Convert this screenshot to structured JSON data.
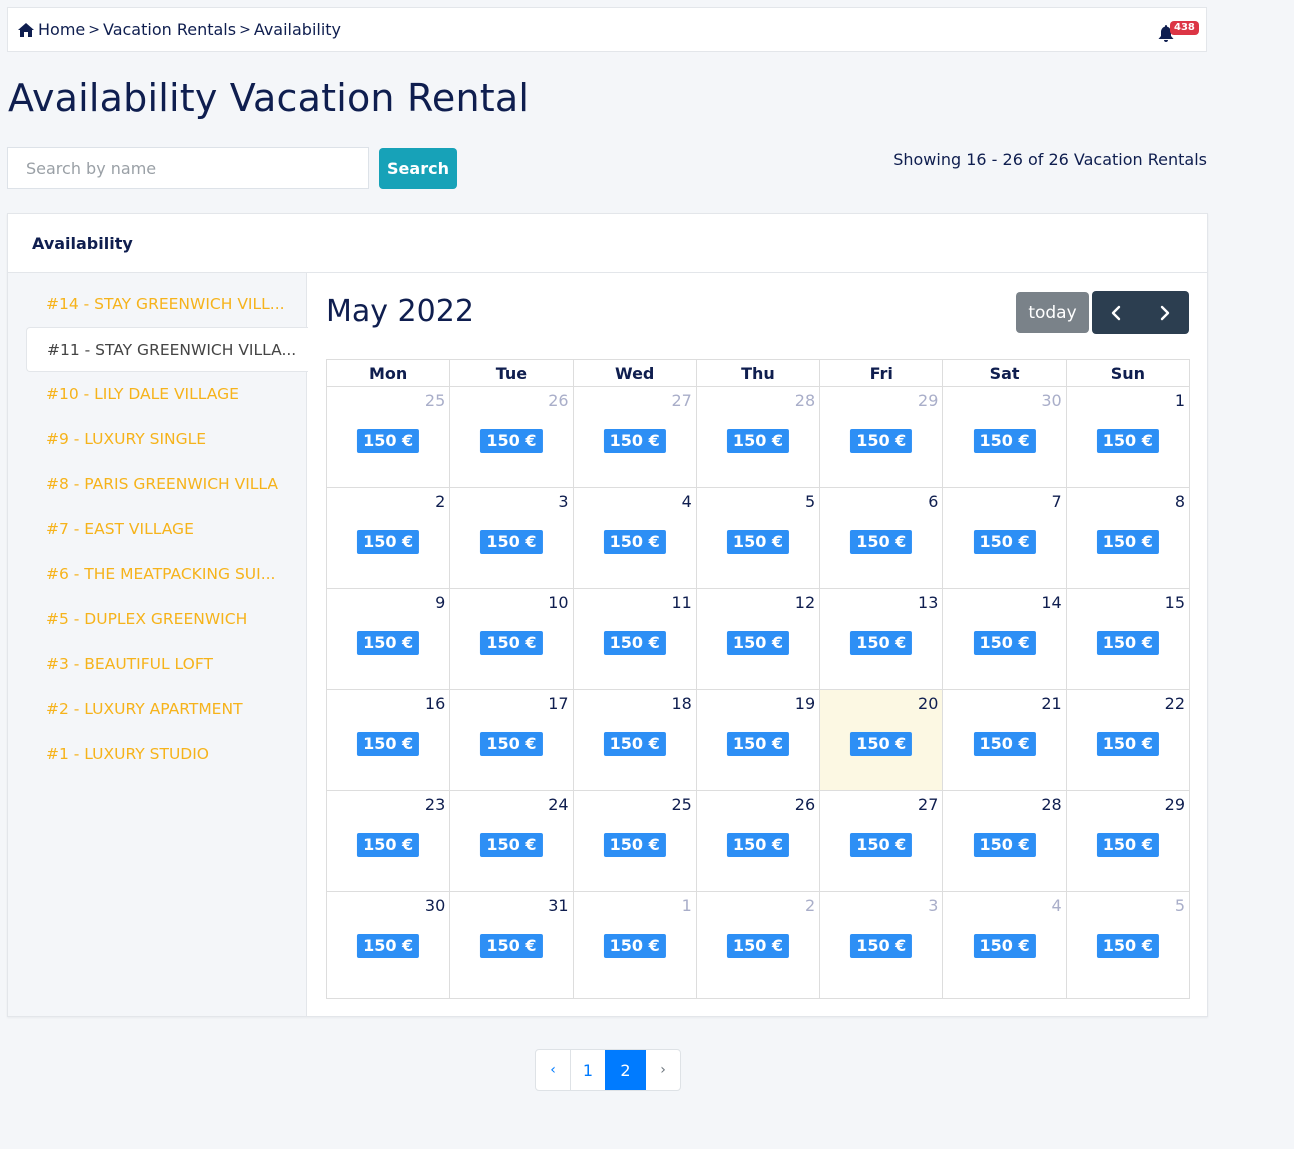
{
  "breadcrumb": {
    "home": "Home",
    "items": [
      "Vacation Rentals",
      "Availability"
    ],
    "separator": ">"
  },
  "notifications": {
    "count": "438"
  },
  "page_title": "Availability Vacation Rental",
  "search": {
    "placeholder": "Search by name",
    "value": "",
    "button_label": "Search"
  },
  "showing_text": "Showing 16 - 26 of 26 Vacation Rentals",
  "card": {
    "title": "Availability"
  },
  "rentals": [
    {
      "label": "#14 - STAY GREENWICH VILL...",
      "active": false
    },
    {
      "label": "#11 - STAY GREENWICH VILLA...",
      "active": true
    },
    {
      "label": "#10 - LILY DALE VILLAGE",
      "active": false
    },
    {
      "label": "#9 - LUXURY SINGLE",
      "active": false
    },
    {
      "label": "#8 - PARIS GREENWICH VILLA",
      "active": false
    },
    {
      "label": "#7 - EAST VILLAGE",
      "active": false
    },
    {
      "label": "#6 - THE MEATPACKING SUI...",
      "active": false
    },
    {
      "label": "#5 - DUPLEX GREENWICH",
      "active": false
    },
    {
      "label": "#3 - BEAUTIFUL LOFT",
      "active": false
    },
    {
      "label": "#2 - LUXURY APARTMENT",
      "active": false
    },
    {
      "label": "#1 - LUXURY STUDIO",
      "active": false
    }
  ],
  "calendar": {
    "title": "May 2022",
    "today_label": "today",
    "weekdays": [
      "Mon",
      "Tue",
      "Wed",
      "Thu",
      "Fri",
      "Sat",
      "Sun"
    ],
    "price_label": "150 €",
    "weeks": [
      [
        {
          "d": "25",
          "other": true
        },
        {
          "d": "26",
          "other": true
        },
        {
          "d": "27",
          "other": true
        },
        {
          "d": "28",
          "other": true
        },
        {
          "d": "29",
          "other": true
        },
        {
          "d": "30",
          "other": true
        },
        {
          "d": "1"
        }
      ],
      [
        {
          "d": "2"
        },
        {
          "d": "3"
        },
        {
          "d": "4"
        },
        {
          "d": "5"
        },
        {
          "d": "6"
        },
        {
          "d": "7"
        },
        {
          "d": "8"
        }
      ],
      [
        {
          "d": "9"
        },
        {
          "d": "10"
        },
        {
          "d": "11"
        },
        {
          "d": "12"
        },
        {
          "d": "13"
        },
        {
          "d": "14"
        },
        {
          "d": "15"
        }
      ],
      [
        {
          "d": "16"
        },
        {
          "d": "17"
        },
        {
          "d": "18"
        },
        {
          "d": "19"
        },
        {
          "d": "20",
          "today": true
        },
        {
          "d": "21"
        },
        {
          "d": "22"
        }
      ],
      [
        {
          "d": "23"
        },
        {
          "d": "24"
        },
        {
          "d": "25"
        },
        {
          "d": "26"
        },
        {
          "d": "27"
        },
        {
          "d": "28"
        },
        {
          "d": "29"
        }
      ],
      [
        {
          "d": "30"
        },
        {
          "d": "31"
        },
        {
          "d": "1",
          "other": true
        },
        {
          "d": "2",
          "other": true
        },
        {
          "d": "3",
          "other": true
        },
        {
          "d": "4",
          "other": true
        },
        {
          "d": "5",
          "other": true
        }
      ]
    ]
  },
  "pagination": {
    "prev": "‹",
    "pages": [
      "1",
      "2"
    ],
    "current": "2",
    "next": "›"
  },
  "colors": {
    "rental_link": "#f6b31b",
    "price_badge": "#2d8ff5",
    "search_button": "#17a2b8",
    "today_highlight": "#fcf8e3",
    "notification_badge": "#dc3545",
    "pagination_active": "#007bff"
  }
}
